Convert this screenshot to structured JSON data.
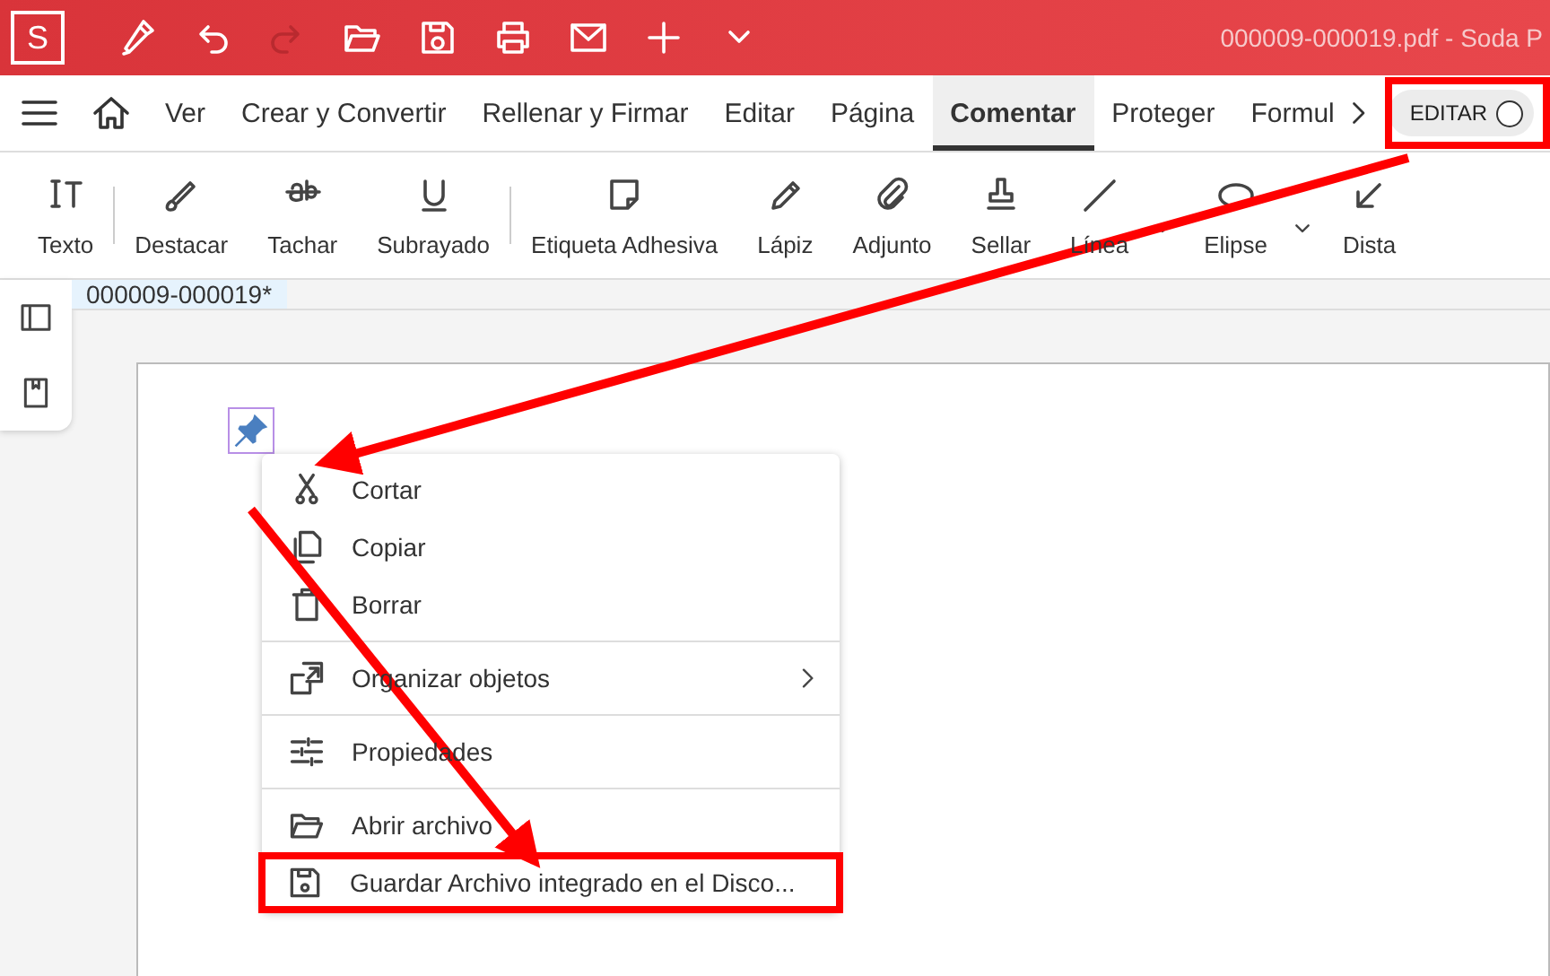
{
  "app": {
    "logo": "S",
    "title": "000009-000019.pdf  -  Soda P"
  },
  "quick_tools": [
    {
      "disabled": false
    },
    {
      "disabled": false
    },
    {
      "disabled": true
    },
    {
      "disabled": false
    },
    {
      "disabled": false
    },
    {
      "disabled": false
    },
    {
      "disabled": false
    },
    {
      "disabled": false
    },
    {
      "disabled": false
    }
  ],
  "tabs": [
    {
      "label": "Ver",
      "selected": false
    },
    {
      "label": "Crear y Convertir",
      "selected": false
    },
    {
      "label": "Rellenar y Firmar",
      "selected": false
    },
    {
      "label": "Editar",
      "selected": false
    },
    {
      "label": "Página",
      "selected": false
    },
    {
      "label": "Comentar",
      "selected": true
    },
    {
      "label": "Proteger",
      "selected": false
    },
    {
      "label": "Formul",
      "selected": false
    }
  ],
  "edit_toggle": {
    "label": "EDITAR",
    "on": false
  },
  "tools": [
    {
      "label": "Texto",
      "dropdown": false,
      "separator_after": true
    },
    {
      "label": "Destacar",
      "dropdown": false,
      "separator_after": false
    },
    {
      "label": "Tachar",
      "dropdown": false,
      "separator_after": false
    },
    {
      "label": "Subrayado",
      "dropdown": false,
      "separator_after": true
    },
    {
      "label": "Etiqueta Adhesiva",
      "dropdown": false,
      "separator_after": false
    },
    {
      "label": "Lápiz",
      "dropdown": false,
      "separator_after": false
    },
    {
      "label": "Adjunto",
      "dropdown": false,
      "separator_after": false
    },
    {
      "label": "Sellar",
      "dropdown": false,
      "separator_after": false
    },
    {
      "label": "Línea",
      "dropdown": true,
      "separator_after": false
    },
    {
      "label": "Elipse",
      "dropdown": true,
      "separator_after": false
    },
    {
      "label": "Dista",
      "dropdown": false,
      "separator_after": false
    }
  ],
  "document_tab": {
    "label": "000009-000019*",
    "selected": true
  },
  "context_menu": [
    {
      "label": "Cortar",
      "submenu": false,
      "group_start": false,
      "highlighted": false
    },
    {
      "label": "Copiar",
      "submenu": false,
      "group_start": false,
      "highlighted": false
    },
    {
      "label": "Borrar",
      "submenu": false,
      "group_start": false,
      "highlighted": false
    },
    {
      "label": "Organizar objetos",
      "submenu": true,
      "group_start": true,
      "highlighted": false
    },
    {
      "label": "Propiedades",
      "submenu": false,
      "group_start": true,
      "highlighted": false
    },
    {
      "label": "Abrir archivo",
      "submenu": false,
      "group_start": true,
      "highlighted": false
    },
    {
      "label": "Guardar Archivo integrado en el Disco...",
      "submenu": false,
      "group_start": false,
      "highlighted": true
    }
  ]
}
